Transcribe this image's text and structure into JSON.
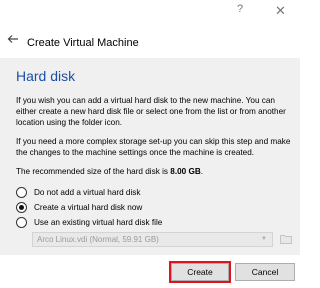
{
  "titlebar": {
    "help_glyph": "?",
    "close_glyph": "✕"
  },
  "header": {
    "title": "Create Virtual Machine"
  },
  "section": {
    "title": "Hard disk"
  },
  "paragraphs": {
    "p1": "If you wish you can add a virtual hard disk to the new machine. You can either create a new hard disk file or select one from the list or from another location using the folder icon.",
    "p2": "If you need a more complex storage set-up you can skip this step and make the changes to the machine settings once the machine is created.",
    "p3_prefix": "The recommended size of the hard disk is ",
    "p3_size": "8.00 GB",
    "p3_suffix": "."
  },
  "options": [
    {
      "label": "Do not add a virtual hard disk",
      "selected": false
    },
    {
      "label": "Create a virtual hard disk now",
      "selected": true
    },
    {
      "label": "Use an existing virtual hard disk file",
      "selected": false
    }
  ],
  "existing_disk": {
    "value": "Arco Linux.vdi (Normal, 59.91 GB)",
    "enabled": false
  },
  "buttons": {
    "create": "Create",
    "cancel": "Cancel"
  },
  "colors": {
    "accent": "#1d4fa3",
    "highlight": "#e0141e",
    "panel_bg": "#f0f0f0"
  }
}
